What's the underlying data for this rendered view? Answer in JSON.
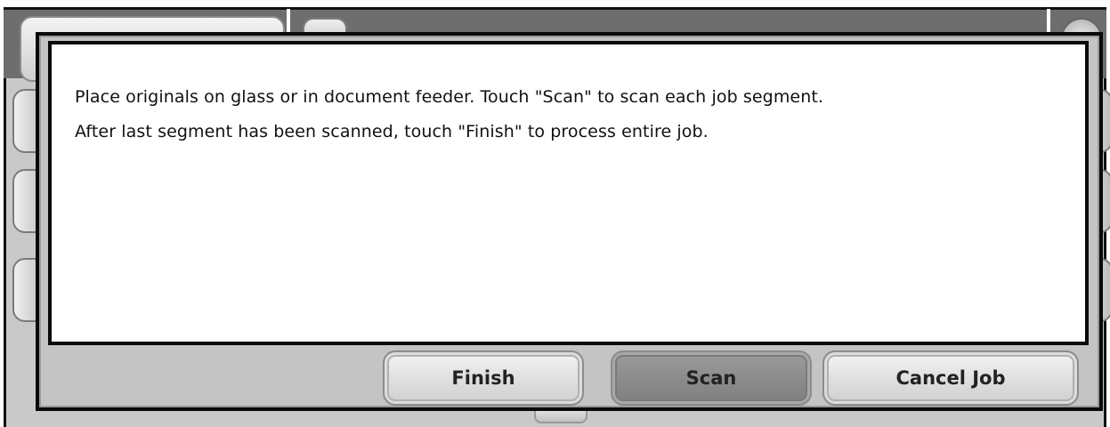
{
  "dialog": {
    "message_lines": [
      "Place originals on glass or in document feeder.  Touch \"Scan\" to scan each job segment.",
      "After last segment has been scanned, touch \"Finish\" to process entire job."
    ],
    "buttons": {
      "finish_label": "Finish",
      "scan_label": "Scan",
      "cancel_label": "Cancel Job"
    }
  },
  "colors": {
    "dialog_border": "#0a0a0a",
    "dialog_background": "#c4c4c4",
    "message_background": "#ffffff",
    "primary_button": "#8c8c8c",
    "header_background": "#6e6e6e"
  }
}
